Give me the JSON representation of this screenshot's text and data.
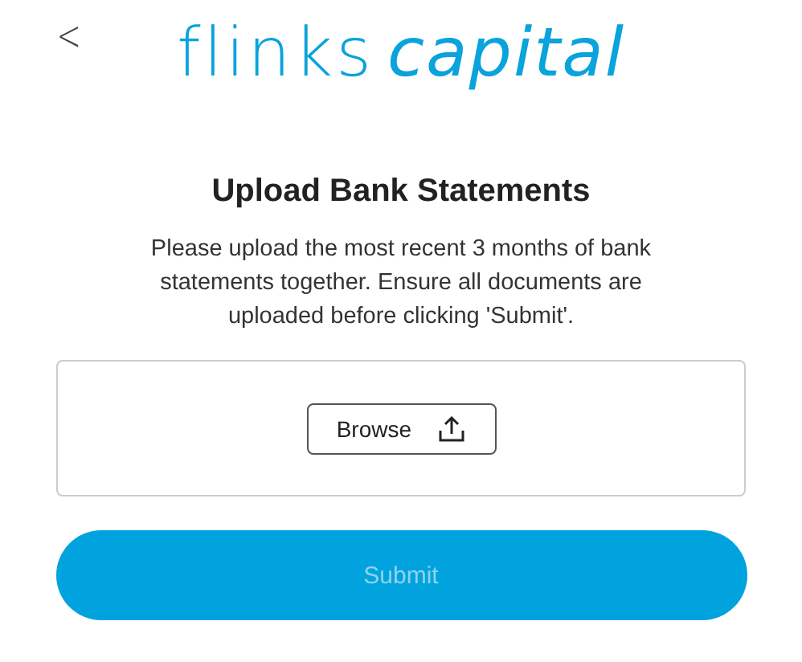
{
  "header": {
    "back": "<",
    "logo": {
      "brand": "flinks",
      "product": "capital"
    }
  },
  "title": "Upload Bank Statements",
  "instructions": "Please upload the most recent 3 months of bank statements together. Ensure all documents are uploaded before clicking 'Submit'.",
  "upload": {
    "browse_label": "Browse"
  },
  "submit": {
    "label": "Submit",
    "disabled": true
  }
}
